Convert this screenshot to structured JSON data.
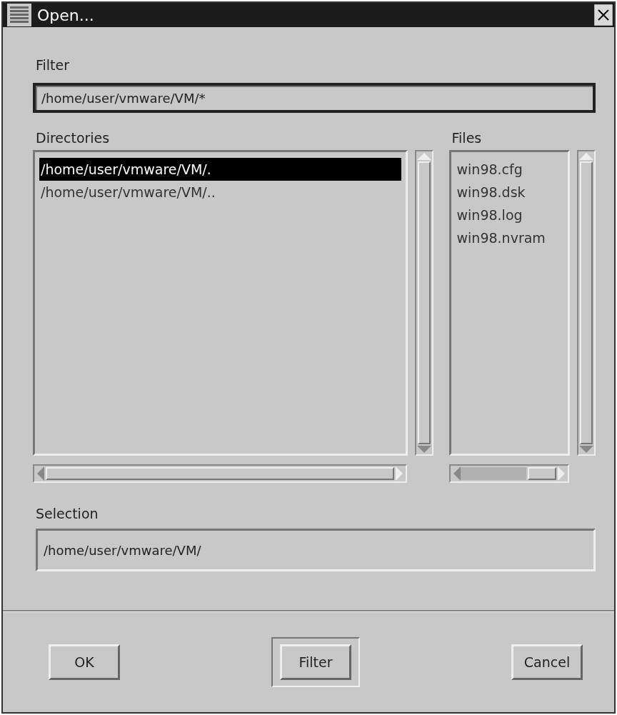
{
  "window": {
    "title": "Open..."
  },
  "filter": {
    "label": "Filter",
    "value": "/home/user/vmware/VM/*",
    "focused": true
  },
  "directories": {
    "label": "Directories",
    "items": [
      {
        "name": "/home/user/vmware/VM/.",
        "selected": true
      },
      {
        "name": "/home/user/vmware/VM/..",
        "selected": false
      }
    ]
  },
  "files": {
    "label": "Files",
    "items": [
      {
        "name": "win98.cfg",
        "selected": false
      },
      {
        "name": "win98.dsk",
        "selected": false
      },
      {
        "name": "win98.log",
        "selected": false
      },
      {
        "name": "win98.nvram",
        "selected": false
      }
    ]
  },
  "selection": {
    "label": "Selection",
    "value": "/home/user/vmware/VM/",
    "focused": false
  },
  "buttons": [
    {
      "label": "OK",
      "default": false
    },
    {
      "label": "Filter",
      "default": true
    },
    {
      "label": "Cancel",
      "default": false
    }
  ]
}
